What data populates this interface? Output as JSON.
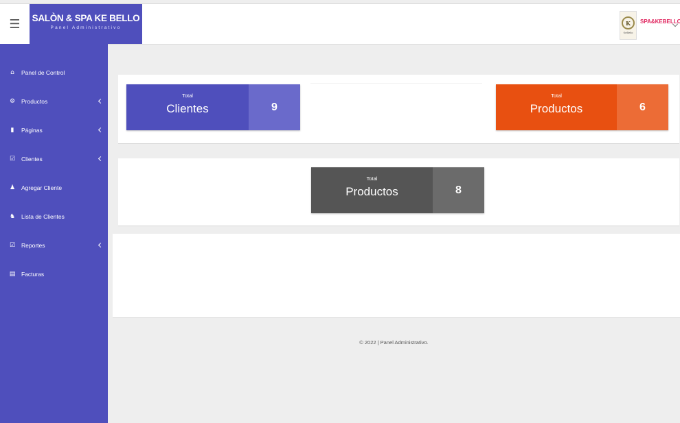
{
  "header": {
    "menu_icon": "hamburger-icon",
    "brand_title": "SALÒN & SPA KE BELLO",
    "brand_subtitle": "Panel Administrativo",
    "user_name": "SPA&KEBELLO",
    "logo_letter": "K",
    "logo_text": "KeBello",
    "accent_color": "#4f4fbc"
  },
  "sidebar": {
    "items": [
      {
        "label": "Panel de Control",
        "icon": "home-icon",
        "glyph": "⌂",
        "has_submenu": false
      },
      {
        "label": "Productos",
        "icon": "gears-icon",
        "glyph": "⚙",
        "has_submenu": true
      },
      {
        "label": "Páginas",
        "icon": "book-icon",
        "glyph": "▮",
        "has_submenu": true
      },
      {
        "label": "Clientes",
        "icon": "checkbox-icon",
        "glyph": "☑",
        "has_submenu": true
      },
      {
        "label": "Agregar Cliente",
        "icon": "user-icon",
        "glyph": "♟",
        "has_submenu": false
      },
      {
        "label": "Lista de Clientes",
        "icon": "users-icon",
        "glyph": "♞",
        "has_submenu": false
      },
      {
        "label": "Reportes",
        "icon": "checkbox-icon",
        "glyph": "☑",
        "has_submenu": true
      },
      {
        "label": "Facturas",
        "icon": "file-icon",
        "glyph": "▤",
        "has_submenu": false
      }
    ]
  },
  "stats": {
    "clients": {
      "label": "Total",
      "title": "Clientes",
      "value": "9",
      "color": "#4f4fbc"
    },
    "products_orange": {
      "label": "Total",
      "title": "Productos",
      "value": "6",
      "color": "#e85011"
    },
    "products_gray": {
      "label": "Total",
      "title": "Productos",
      "value": "8",
      "color": "#555555"
    }
  },
  "footer": {
    "text": "© 2022 | Panel Administrativo."
  }
}
